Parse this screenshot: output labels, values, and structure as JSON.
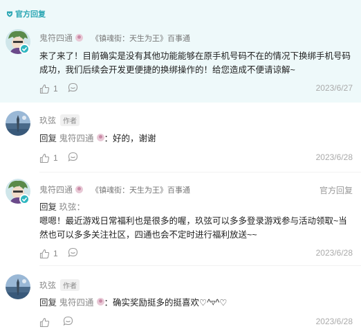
{
  "official_block": {
    "tag": "官方回复",
    "comment": {
      "name": "鬼符四通",
      "channel": "《镇魂街：天生为王》百事通",
      "text": "来了来了！目前确实是没有其他功能能够在原手机号码不在的情况下换绑手机号码成功，我们后续会开发更便捷的换绑操作的！给您造成不便请谅解~",
      "likes": "1",
      "date": "2023/6/27"
    }
  },
  "comments": [
    {
      "name": "玖弦",
      "author_tag": "作者",
      "reply_prefix": "回复",
      "reply_to": "鬼符四通",
      "text": "：好的，谢谢",
      "likes": "1",
      "date": "2023/6/28"
    },
    {
      "name": "鬼符四通",
      "channel": "《镇魂街：天生为王》百事通",
      "side_label": "官方回复",
      "reply_prefix": "回复",
      "reply_to": "玖弦：",
      "text": "嗯嗯！最近游戏日常福利也是很多的喔，玖弦可以多多登录游戏参与活动领取~当然也可以多多关注社区，四通也会不定时进行福利放送~~",
      "likes": "1",
      "date": "2023/6/28"
    },
    {
      "name": "玖弦",
      "author_tag": "作者",
      "reply_prefix": "回复",
      "reply_to": "鬼符四通",
      "text": "：确实奖励挺多的挺喜欢♡^▿^♡",
      "date": "2023/6/28"
    }
  ],
  "colors": {
    "official_bg": "#eef9fa",
    "accent": "#2aa6b3",
    "verified": "#2eb6c0"
  }
}
